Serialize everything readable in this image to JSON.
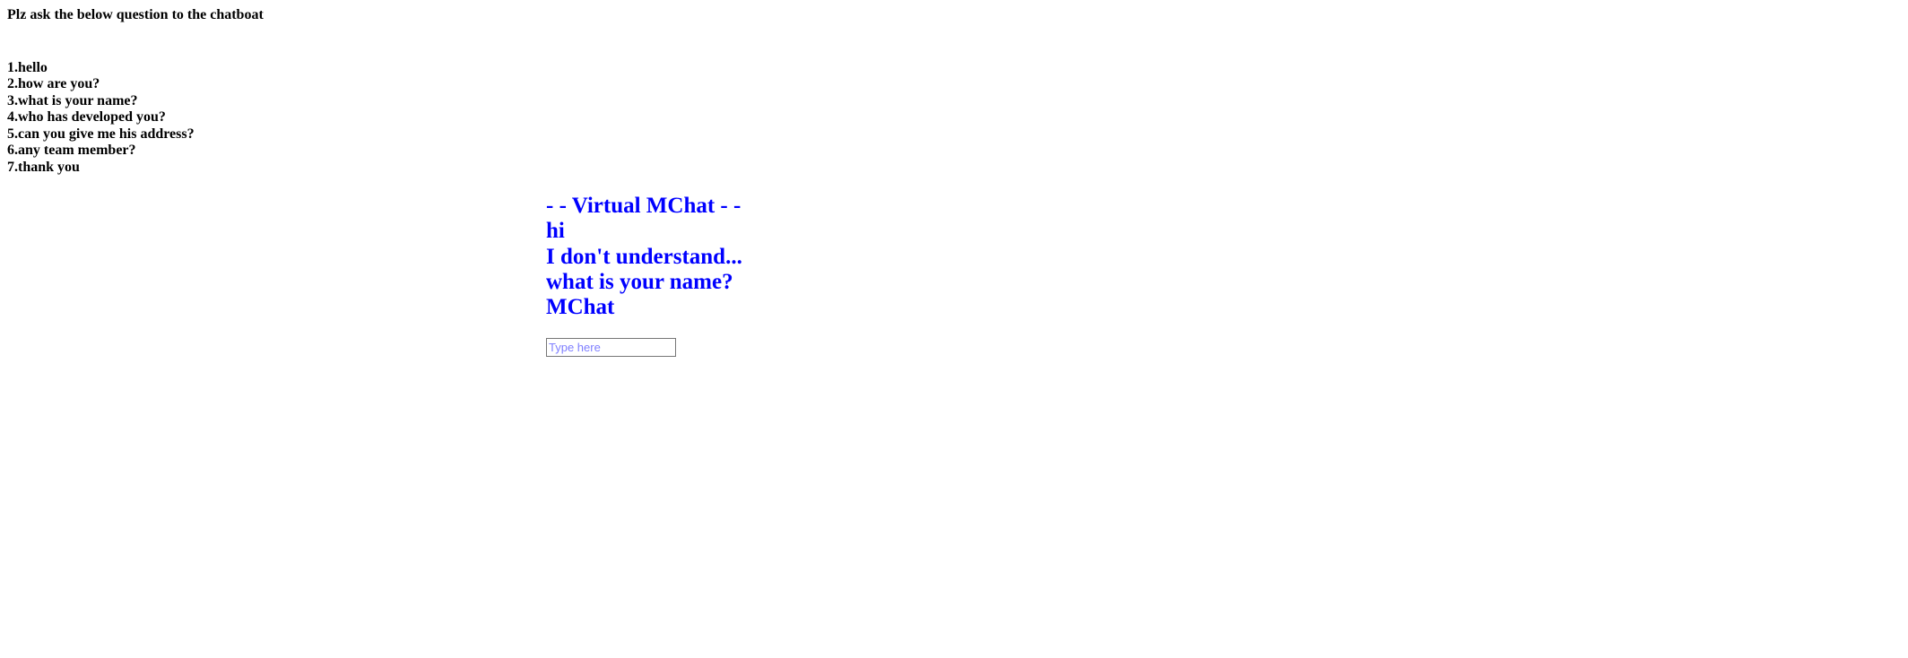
{
  "instructions": {
    "heading": "Plz ask the below question to the chatboat",
    "questions": [
      "1.hello",
      "2.how are you?",
      "3.what is your name?",
      "4.who has developed you?",
      "5.can you give me his address?",
      "6.any team member?",
      "7.thank you"
    ]
  },
  "chat": {
    "title": "- - Virtual MChat - -",
    "messages": [
      "hi",
      "I don't understand...",
      "what is your name?",
      "MChat"
    ],
    "input": {
      "value": "",
      "placeholder": "Type here"
    },
    "text_color": "#0000ff"
  }
}
